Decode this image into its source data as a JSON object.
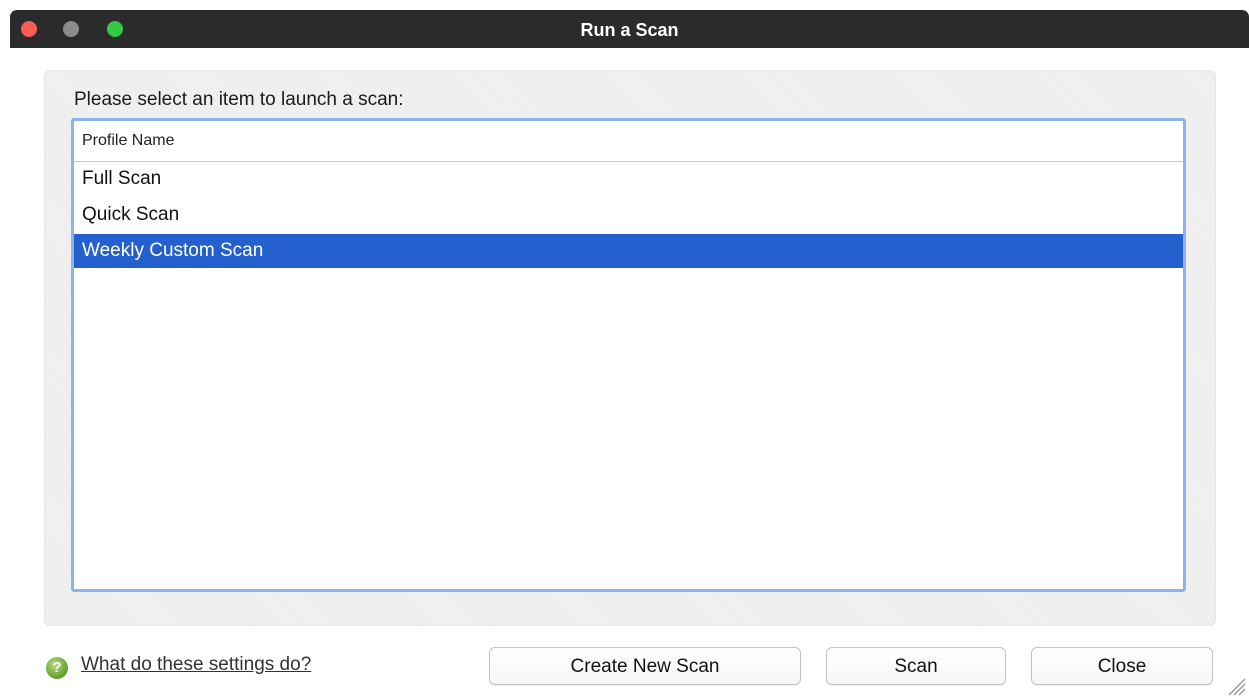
{
  "window": {
    "title": "Run a Scan"
  },
  "dialog": {
    "prompt": "Please select an item to launch a scan:",
    "list": {
      "column_header": "Profile Name",
      "items": [
        "Full Scan",
        "Quick Scan",
        "Weekly Custom Scan"
      ],
      "selected_item": "Weekly Custom Scan"
    },
    "help": {
      "icon": "help-question-icon",
      "link_text": "What do these settings do?"
    },
    "buttons": {
      "create_new_scan": "Create New Scan",
      "scan": "Scan",
      "close": "Close"
    }
  },
  "colors": {
    "titlebar": "#2b2b2b",
    "selection": "#2460cd",
    "list_focus_border": "#8db3e8",
    "close_dot": "#fc5c55",
    "minimize_dot": "#8b8b8b",
    "zoom_dot": "#34c748"
  }
}
